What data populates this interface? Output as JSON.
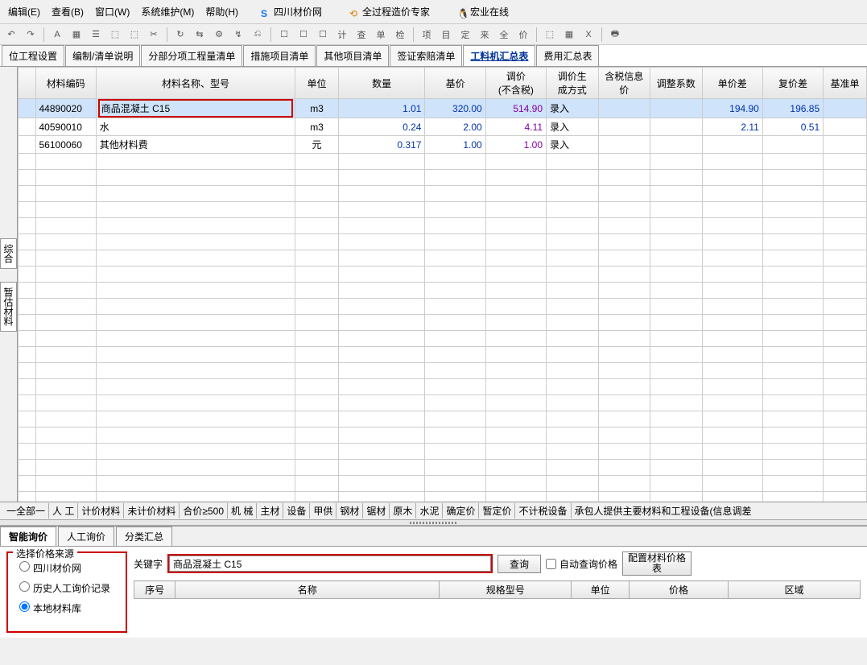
{
  "menubar": {
    "items": [
      "编辑(E)",
      "查看(B)",
      "窗口(W)",
      "系统维护(M)",
      "帮助(H)"
    ],
    "ext": [
      {
        "icon": "S",
        "label": "四川材价网",
        "color": "#1a73e8"
      },
      {
        "icon": "⟲",
        "label": "全过程造价专家",
        "color": "#e07c00"
      },
      {
        "icon": "🐧",
        "label": "宏业在线",
        "color": "#333"
      }
    ]
  },
  "toolbar": {
    "icons": [
      "↶",
      "↷",
      "|",
      "A",
      "▦",
      "☰",
      "⬚",
      "⬚",
      "✂",
      "|",
      "↻",
      "⇆",
      "⚙",
      "↯",
      "⎌",
      "|",
      "☐",
      "☐",
      "☐",
      "计",
      "查",
      "单",
      "检",
      "|",
      "项",
      "目",
      "定",
      "来",
      "全",
      "价",
      "|",
      "⬚",
      "▦",
      "X",
      "|",
      "🖶"
    ]
  },
  "tabs": {
    "items": [
      "位工程设置",
      "编制/清单说明",
      "分部分项工程量清单",
      "措施项目清单",
      "其他项目清单",
      "签证索赔清单",
      "工料机汇总表",
      "费用汇总表"
    ],
    "active": 6
  },
  "vtabs": {
    "items": [
      "综合",
      "暂估材料"
    ],
    "active": 1
  },
  "grid": {
    "headers": [
      "材料编码",
      "材料名称、型号",
      "单位",
      "数量",
      "基价",
      "调价\n(不含税)",
      "调价生\n成方式",
      "含税信息\n价",
      "调整系数",
      "单价差",
      "复价差",
      "基准单"
    ],
    "widths": [
      70,
      230,
      50,
      100,
      70,
      70,
      60,
      60,
      60,
      70,
      70,
      50
    ],
    "rows": [
      {
        "code": "44890020",
        "name": "商品混凝土 C15",
        "unit": "m3",
        "qty": "1.01",
        "base": "320.00",
        "adj": "514.90",
        "mode": "录入",
        "tax": "",
        "coef": "",
        "d1": "194.90",
        "d2": "196.85",
        "selected": true,
        "hl": true
      },
      {
        "code": "40590010",
        "name": "水",
        "unit": "m3",
        "qty": "0.24",
        "base": "2.00",
        "adj": "4.11",
        "mode": "录入",
        "tax": "",
        "coef": "",
        "d1": "2.11",
        "d2": "0.51"
      },
      {
        "code": "56100060",
        "name": "其他材料费",
        "unit": "元",
        "qty": "0.317",
        "base": "1.00",
        "adj": "1.00",
        "mode": "录入",
        "tax": "",
        "coef": "",
        "d1": "",
        "d2": ""
      }
    ],
    "blank_rows": 22
  },
  "bottom_tabs": [
    "一全部一",
    "人 工",
    "计价材料",
    "未计价材料",
    "合价≥500",
    "机 械",
    "主材",
    "设备",
    "甲供",
    "钢材",
    "锯材",
    "原木",
    "水泥",
    "确定价",
    "暂定价",
    "不计税设备",
    "承包人提供主要材料和工程设备(信息调差"
  ],
  "panel": {
    "tabs": [
      "智能询价",
      "人工询价",
      "分类汇总"
    ],
    "active": 0,
    "source": {
      "legend": "选择价格来源",
      "options": [
        {
          "label": "四川材价网",
          "checked": false
        },
        {
          "label": "历史人工询价记录",
          "checked": false
        },
        {
          "label": "本地材料库",
          "checked": true
        }
      ]
    },
    "keyword_label": "关键字",
    "keyword_value": "商品混凝土 C15",
    "query_btn": "查询",
    "auto_chk": "自动查询价格",
    "config_btn": "配置材料价格\n表",
    "result_headers": [
      "序号",
      "名称",
      "规格型号",
      "单位",
      "价格",
      "区域"
    ],
    "result_widths": [
      50,
      320,
      160,
      70,
      120,
      160
    ]
  }
}
